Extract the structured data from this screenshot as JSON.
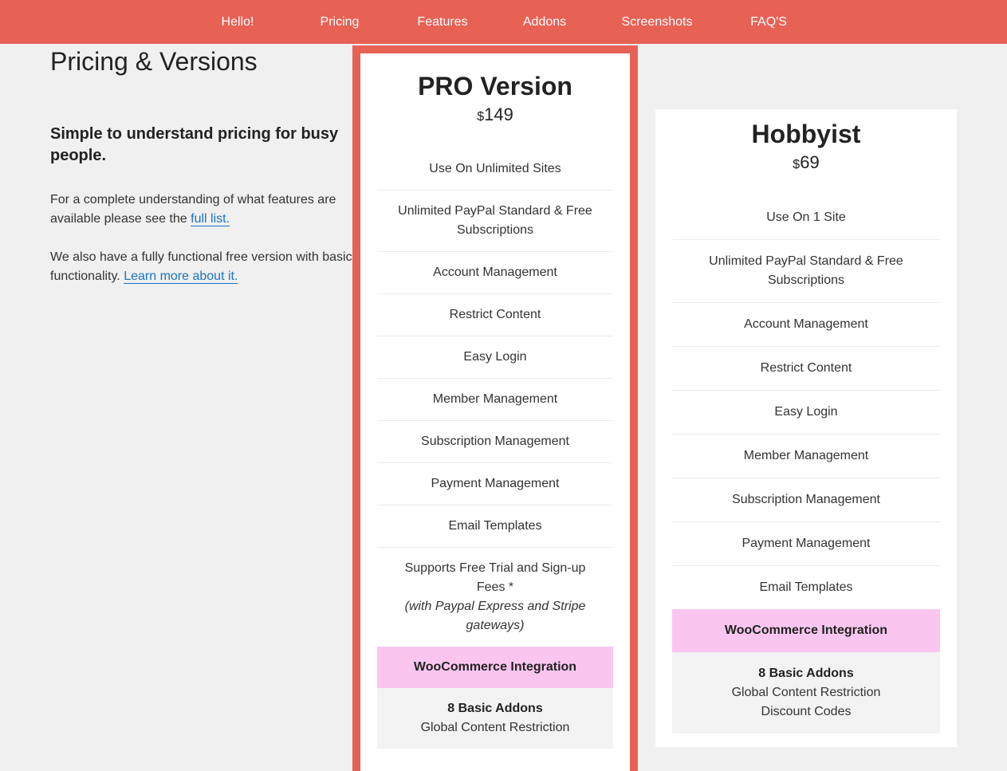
{
  "nav": {
    "items": [
      {
        "label": "Hello!"
      },
      {
        "label": "Pricing"
      },
      {
        "label": "Features"
      },
      {
        "label": "Addons"
      },
      {
        "label": "Screenshots"
      },
      {
        "label": "FAQ'S"
      }
    ]
  },
  "colors": {
    "brand": "#e76155",
    "highlight_row": "#fac6f0",
    "link": "#1a73c6"
  },
  "page": {
    "title": "Pricing & Versions",
    "subtitle": "Simple to understand pricing for busy people.",
    "para1_text": "For a complete understanding of what features are available please see the ",
    "para1_link": "full list.",
    "para2_text": "We also have a fully functional free version with basic functionality. ",
    "para2_link": "Learn more about it."
  },
  "plans": {
    "pro": {
      "title_bold": "PRO",
      "title_rest": " Version",
      "currency": "$",
      "price": "149",
      "features": [
        "Use On Unlimited Sites",
        "Unlimited PayPal Standard & Free Subscriptions",
        "Account Management",
        "Restrict Content",
        "Easy Login",
        "Member Management",
        "Subscription Management",
        "Payment Management",
        "Email Templates"
      ],
      "trial_feature": "Supports Free Trial and Sign-up Fees *",
      "trial_note": "(with Paypal Express and Stripe gateways)",
      "woo": "WooCommerce Integration",
      "addons_title": "8 Basic Addons",
      "addons": [
        "Global Content Restriction"
      ]
    },
    "hobbyist": {
      "title": "Hobbyist",
      "currency": "$",
      "price": "69",
      "features": [
        "Use On 1 Site",
        "Unlimited PayPal Standard & Free Subscriptions",
        "Account Management",
        "Restrict Content",
        "Easy Login",
        "Member Management",
        "Subscription Management",
        "Payment Management",
        "Email Templates"
      ],
      "woo": "WooCommerce Integration",
      "addons_title": "8 Basic Addons",
      "addons": [
        "Global Content Restriction",
        "Discount Codes"
      ]
    }
  }
}
